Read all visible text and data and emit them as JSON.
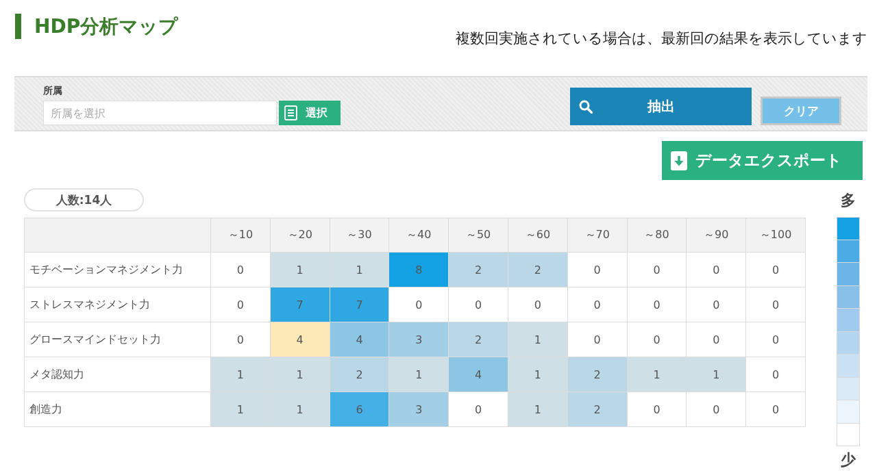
{
  "header": {
    "title": "HDP分析マップ",
    "note": "複数回実施されている場合は、最新回の結果を表示しています"
  },
  "filter": {
    "label": "所属",
    "placeholder": "所属を選択",
    "select_button": "選択",
    "extract_button": "抽出",
    "clear_button": "クリア"
  },
  "export_button": "データエクスポート",
  "headcount": "人数:14人",
  "table": {
    "columns": [
      "～10",
      "～20",
      "～30",
      "～40",
      "～50",
      "～60",
      "～70",
      "～80",
      "～90",
      "～100"
    ],
    "rows": [
      {
        "label": "モチベーションマネジメント力",
        "cells": [
          {
            "value": "0",
            "color": "#ffffff"
          },
          {
            "value": "1",
            "color": "#cfdfe6"
          },
          {
            "value": "1",
            "color": "#cfdfe6"
          },
          {
            "value": "8",
            "color": "#14a1e3"
          },
          {
            "value": "2",
            "color": "#b9d7e7"
          },
          {
            "value": "2",
            "color": "#b9d7e7"
          },
          {
            "value": "0",
            "color": "#ffffff"
          },
          {
            "value": "0",
            "color": "#ffffff"
          },
          {
            "value": "0",
            "color": "#ffffff"
          },
          {
            "value": "0",
            "color": "#ffffff"
          }
        ]
      },
      {
        "label": "ストレスマネジメント力",
        "cells": [
          {
            "value": "0",
            "color": "#ffffff"
          },
          {
            "value": "7",
            "color": "#2fa7e3"
          },
          {
            "value": "7",
            "color": "#2fa7e3"
          },
          {
            "value": "0",
            "color": "#ffffff"
          },
          {
            "value": "0",
            "color": "#ffffff"
          },
          {
            "value": "0",
            "color": "#ffffff"
          },
          {
            "value": "0",
            "color": "#ffffff"
          },
          {
            "value": "0",
            "color": "#ffffff"
          },
          {
            "value": "0",
            "color": "#ffffff"
          },
          {
            "value": "0",
            "color": "#ffffff"
          }
        ]
      },
      {
        "label": "グロースマインドセット力",
        "cells": [
          {
            "value": "0",
            "color": "#ffffff"
          },
          {
            "value": "4",
            "color": "#fde9b7"
          },
          {
            "value": "4",
            "color": "#8bc6e5"
          },
          {
            "value": "3",
            "color": "#a3cfe6"
          },
          {
            "value": "2",
            "color": "#b9d7e7"
          },
          {
            "value": "1",
            "color": "#cfdfe6"
          },
          {
            "value": "0",
            "color": "#ffffff"
          },
          {
            "value": "0",
            "color": "#ffffff"
          },
          {
            "value": "0",
            "color": "#ffffff"
          },
          {
            "value": "0",
            "color": "#ffffff"
          }
        ]
      },
      {
        "label": "メタ認知力",
        "cells": [
          {
            "value": "1",
            "color": "#cfdfe6"
          },
          {
            "value": "1",
            "color": "#cfdfe6"
          },
          {
            "value": "2",
            "color": "#b9d7e7"
          },
          {
            "value": "1",
            "color": "#cfdfe6"
          },
          {
            "value": "4",
            "color": "#8bc6e5"
          },
          {
            "value": "1",
            "color": "#cfdfe6"
          },
          {
            "value": "2",
            "color": "#b9d7e7"
          },
          {
            "value": "1",
            "color": "#cfdfe6"
          },
          {
            "value": "1",
            "color": "#cfdfe6"
          },
          {
            "value": "0",
            "color": "#ffffff"
          }
        ]
      },
      {
        "label": "創造力",
        "cells": [
          {
            "value": "1",
            "color": "#cfdfe6"
          },
          {
            "value": "1",
            "color": "#cfdfe6"
          },
          {
            "value": "6",
            "color": "#45b0e5"
          },
          {
            "value": "3",
            "color": "#a3cfe6"
          },
          {
            "value": "0",
            "color": "#ffffff"
          },
          {
            "value": "1",
            "color": "#cfdfe6"
          },
          {
            "value": "2",
            "color": "#b9d7e7"
          },
          {
            "value": "0",
            "color": "#ffffff"
          },
          {
            "value": "0",
            "color": "#ffffff"
          },
          {
            "value": "0",
            "color": "#ffffff"
          }
        ]
      }
    ]
  },
  "legend": {
    "high": "多",
    "low": "少",
    "swatches": [
      {
        "color": "#14a0e2"
      },
      {
        "color": "#4aabe5"
      },
      {
        "color": "#6cb5e8"
      },
      {
        "color": "#88c0ea"
      },
      {
        "color": "#a1cbee"
      },
      {
        "color": "#b5d6f0"
      },
      {
        "color": "#cae1f4"
      },
      {
        "color": "#dbeaf7"
      },
      {
        "color": "#ecf4fc"
      },
      {
        "color": "#ffffff"
      }
    ]
  }
}
